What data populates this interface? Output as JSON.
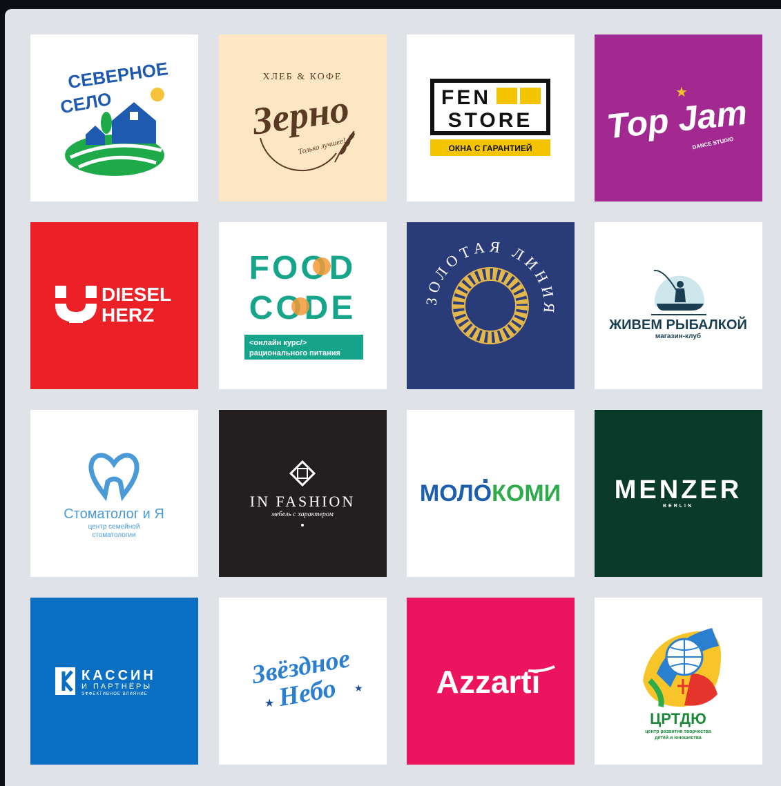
{
  "colors": {
    "frame": "#0e0f14",
    "panel": "#dfe3e8"
  },
  "logos": [
    {
      "name": "severnoe-selo",
      "bg": "#ffffff",
      "line1": "СЕВЕРНОЕ",
      "line2": "СЕЛО",
      "icon": "house-field-icon"
    },
    {
      "name": "zerno",
      "bg": "#fde6c4",
      "top": "ХЛЕБ & КОФЕ",
      "title": "Зерно",
      "tagline": "Только лучшее!",
      "icon": "wheat-icon"
    },
    {
      "name": "fen-store",
      "bg": "#ffffff",
      "line1": "FEN",
      "line2": "STORE",
      "bar": "ОКНА С ГАРАНТИЕЙ"
    },
    {
      "name": "top-jam",
      "bg": "#a1298f",
      "title": "Top Jam",
      "sub": "DANCE STUDIO",
      "icon": "star-icon"
    },
    {
      "name": "diesel-herz",
      "bg": "#ec2027",
      "line1": "DIESEL",
      "line2": "HERZ",
      "icon": "herz-mark-icon"
    },
    {
      "name": "food-code",
      "bg": "#ffffff",
      "line1": "FOOD",
      "line2": "CODE",
      "box1": "<онлайн курс/>",
      "box2": "рационального питания"
    },
    {
      "name": "zolotaya-liniya",
      "bg": "#2a3b7a",
      "ring": "ЗОЛОТАЯ ЛИНИЯ",
      "icon": "ornament-ring-icon"
    },
    {
      "name": "zhivem-rybalkoy",
      "bg": "#ffffff",
      "title": "ЖИВЕМ РЫБАЛКОЙ",
      "sub": "магазин-клуб",
      "icon": "fisherman-icon"
    },
    {
      "name": "stomatolog",
      "bg": "#ffffff",
      "title": "Стоматолог и Я",
      "sub1": "центр семейной",
      "sub2": "стоматологии",
      "icon": "tooth-heart-icon"
    },
    {
      "name": "in-fashion",
      "bg": "#231f20",
      "title": "IN FASHION",
      "sub": "мебель с характером",
      "icon": "knot-icon"
    },
    {
      "name": "molokomi",
      "bg": "#ffffff",
      "title1": "МОЛО",
      "title2": "КОМИ",
      "icon": "bottle-icon"
    },
    {
      "name": "menzer",
      "bg": "#0a3b2a",
      "title": "MENZER",
      "sub": "BERLIN"
    },
    {
      "name": "kassin",
      "bg": "#0a6fc2",
      "line1": "КАССИН",
      "line2": "И ПАРТНЁРЫ",
      "line3": "ЭФФЕКТИВНОЕ ВЛИЯНИЕ",
      "icon": "k-mark-icon"
    },
    {
      "name": "zvezdnoe-nebo",
      "bg": "#ffffff",
      "line1": "Звёздное",
      "line2": "Небо",
      "icon": "stars-icon"
    },
    {
      "name": "azzarti",
      "bg": "#ec145f",
      "title": "Azzarti"
    },
    {
      "name": "crtdyu",
      "bg": "#ffffff",
      "title": "ЦРТДЮ",
      "sub1": "центр развития творчества",
      "sub2": "детей и юношества",
      "icon": "globe-figure-icon"
    }
  ]
}
